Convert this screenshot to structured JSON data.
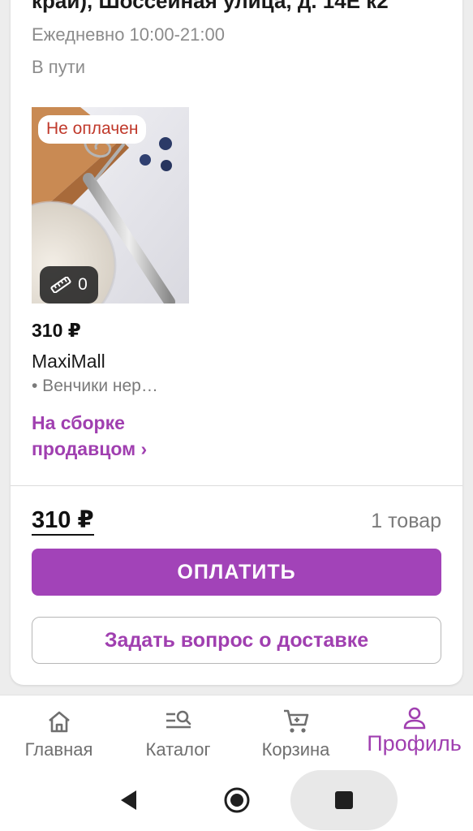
{
  "order": {
    "address": "край), Шоссейная улица, д. 14Е к2",
    "hours": "Ежедневно 10:00-21:00",
    "status": "В пути"
  },
  "product": {
    "badge": "Не оплачен",
    "size_count": "0",
    "price": "310 ₽",
    "seller": "MaxiMall",
    "name": "• Венчики нер…",
    "assembly_status": "На сборке продавцом ›"
  },
  "summary": {
    "total": "310 ₽",
    "count": "1 товар"
  },
  "actions": {
    "pay_label": "ОПЛАТИТЬ",
    "question_label": "Задать вопрос о доставке"
  },
  "nav": {
    "items": [
      {
        "label": "Главная",
        "icon": "home-icon"
      },
      {
        "label": "Каталог",
        "icon": "catalog-search-icon"
      },
      {
        "label": "Корзина",
        "icon": "cart-icon"
      },
      {
        "label": "Профиль",
        "icon": "profile-icon",
        "active": true
      }
    ]
  },
  "colors": {
    "accent": "#a243b8",
    "unpaid": "#c0392b",
    "muted": "#8c8c8c"
  }
}
